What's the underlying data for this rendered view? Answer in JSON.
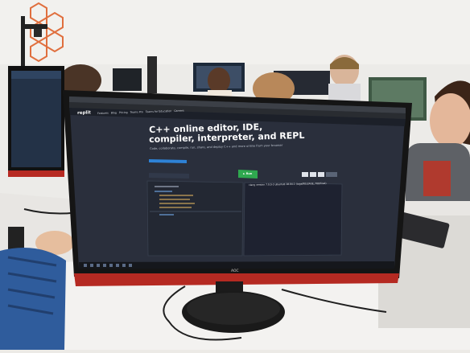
{
  "screen": {
    "brand": "replit",
    "nav": [
      "Features",
      "Blog",
      "Pricing",
      "Teams Pro",
      "Teams for Education",
      "Careers"
    ],
    "hero_line1": "C++ online editor, IDE,",
    "hero_line2": "compiler, interpreter, and REPL",
    "hero_sub": "Code, collaborate, compile, run, share, and deploy C++ and more online from your browser",
    "run_label": "► Run",
    "console_text": "clang version 7.0.0-3 ubuntu0.18.04.1 (tags/RELEASE_700/final)"
  },
  "monitor": {
    "logo": "AOC"
  },
  "colors": {
    "screen_bg": "#2b3140",
    "accent_run": "#2fa84f",
    "bezel": "#161616",
    "stand_red": "#b52a22"
  }
}
